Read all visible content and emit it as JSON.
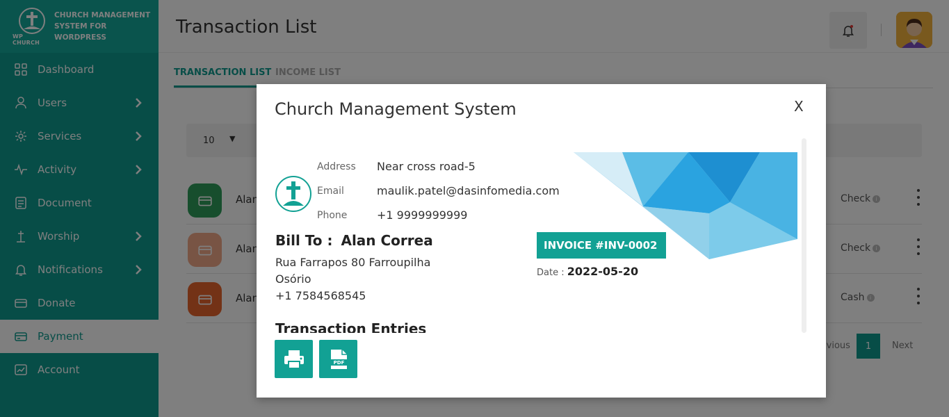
{
  "brand": {
    "logo_text": "WP CHURCH",
    "title": "CHURCH MANAGEMENT SYSTEM FOR WORDPRESS"
  },
  "sidebar": {
    "items": [
      {
        "label": "Dashboard",
        "icon": "dashboard-icon",
        "has_submenu": false
      },
      {
        "label": "Users",
        "icon": "user-icon",
        "has_submenu": true
      },
      {
        "label": "Services",
        "icon": "services-icon",
        "has_submenu": true
      },
      {
        "label": "Activity",
        "icon": "activity-icon",
        "has_submenu": true
      },
      {
        "label": "Document",
        "icon": "document-icon",
        "has_submenu": false
      },
      {
        "label": "Worship",
        "icon": "worship-icon",
        "has_submenu": true
      },
      {
        "label": "Notifications",
        "icon": "bell-icon",
        "has_submenu": true
      },
      {
        "label": "Donate",
        "icon": "donate-icon",
        "has_submenu": false
      },
      {
        "label": "Payment",
        "icon": "payment-icon",
        "has_submenu": false,
        "active": true
      },
      {
        "label": "Account",
        "icon": "account-icon",
        "has_submenu": false
      }
    ]
  },
  "header": {
    "title": "Transaction List"
  },
  "tabs": [
    {
      "label": "TRANSACTION LIST",
      "active": true
    },
    {
      "label": "INCOME LIST",
      "active": false
    }
  ],
  "table": {
    "page_size": "10",
    "rows": [
      {
        "name": "Alan Correa",
        "method": "Check",
        "icon_color": "#2e9c5a"
      },
      {
        "name": "Alan Correa",
        "method": "Check",
        "icon_color": "#f0a988"
      },
      {
        "name": "Alan Correa",
        "method": "Cash",
        "icon_color": "#e6642c"
      }
    ],
    "pagination": {
      "prev": "Previous",
      "current": "1",
      "next": "Next"
    }
  },
  "modal": {
    "title": "Church Management System",
    "close": "X",
    "address_label": "Address",
    "address": "Near cross road-5",
    "email_label": "Email",
    "email": "maulik.patel@dasinfomedia.com",
    "phone_label": "Phone",
    "phone": "+1 9999999999",
    "bill_to_label": "Bill To :",
    "bill_to_name": "Alan Correa",
    "bill_address_1": "Rua Farrapos 80 Farroupilha",
    "bill_address_2": "Osório",
    "bill_phone": "+1 7584568545",
    "invoice_label": "INVOICE #INV-0002",
    "date_label": "Date :",
    "date": "2022-05-20",
    "entries_title": "Transaction Entries"
  },
  "colors": {
    "primary": "#0f9a8f",
    "brand": "#14a89b",
    "accent": "#12a194"
  }
}
